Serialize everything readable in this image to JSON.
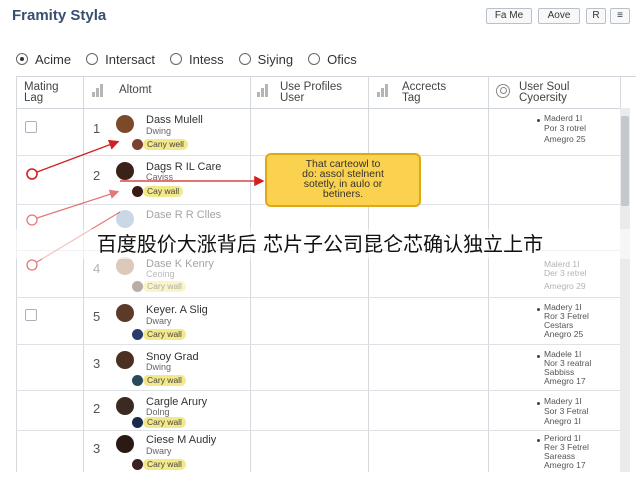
{
  "app": {
    "title": "Framity Styla"
  },
  "toolbar": {
    "btn1": "Fa Me",
    "btn2": "Aove",
    "btn3": "R",
    "btn4": "≡"
  },
  "filters": [
    {
      "label": "Acime",
      "selected": true
    },
    {
      "label": "Intersact",
      "selected": false
    },
    {
      "label": "Intess",
      "selected": false
    },
    {
      "label": "Siying",
      "selected": false
    },
    {
      "label": "Ofics",
      "selected": false
    }
  ],
  "columns": {
    "c1_line1": "Mating",
    "c1_line2": "Lag",
    "c2": "Altomt",
    "c3_line1": "Use Profiles",
    "c3_line2": "User",
    "c4_line1": "Accrects",
    "c4_line2": "Tag",
    "c5_line1": "User Soul",
    "c5_line2": "Cyoersity"
  },
  "rows": [
    {
      "num": "1",
      "name": "Dass Mulell",
      "role": "Dwing",
      "tag": "Cany well",
      "info1": "Maderd 1I",
      "info2": "Por 3 rotrel",
      "info3": "Amegro 25",
      "avatar": "#7b4a2a"
    },
    {
      "num": "2",
      "name": "Dags R IL Care",
      "role": "Caviss",
      "tag": "Cay wall",
      "info1": "",
      "info2": "",
      "info3": "",
      "avatar": "#3b2218"
    },
    {
      "num": "",
      "name": "Dase R R Clles",
      "role": "",
      "tag": "",
      "info1": "",
      "info2": "",
      "info3": "",
      "avatar": "#8aa8c8"
    },
    {
      "num": "4",
      "name": "Dase K Kenry",
      "role": "Ceoing",
      "tag": "Cary wall",
      "info1": "Malerd 1I",
      "info2": "Der 3 retrel",
      "info3": "Amegro 29",
      "avatar": "#b58a6a"
    },
    {
      "num": "5",
      "name": "Keyer. A Slig",
      "role": "Dwary",
      "tag": "Cary wall",
      "info1": "Madery 1I",
      "info2": "Ror 3 Fetrel",
      "info3": "Cestars",
      "info4": "Anegro 25",
      "avatar": "#5b3a2a"
    },
    {
      "num": "3",
      "name": "Snoy Grad",
      "role": "Dwing",
      "tag": "Cary wall",
      "info1": "Madele 1I",
      "info2": "Nor 3 reatral",
      "info3": "Sabbiss",
      "info4": "Amegro 17",
      "avatar": "#4a3020"
    },
    {
      "num": "2",
      "name": "Cargle Arury",
      "role": "Dolng",
      "tag": "Cary wall",
      "info1": "Madery 1I",
      "info2": "Sor 3 Fetral",
      "info3": "Anegro 1I",
      "avatar": "#3a2a22"
    },
    {
      "num": "3",
      "name": "Ciese M Audiy",
      "role": "Dwary",
      "tag": "Cary wall",
      "info1": "Periord 1I",
      "info2": "Rer 3 Fetrel",
      "info3": "Sareass",
      "info4": "Amegro 17",
      "avatar": "#2a1a14"
    }
  ],
  "callout": {
    "line1": "That carteowl to",
    "line2": "do: assol stelnent",
    "line3": "sotetly, in aulo or",
    "line4": "betiners."
  },
  "headline": "百度股价大涨背后 芯片子公司昆仑芯确认独立上市",
  "colors": {
    "accent": "#d32020",
    "callout": "#fbd24f",
    "tag": "#f3e98a"
  }
}
